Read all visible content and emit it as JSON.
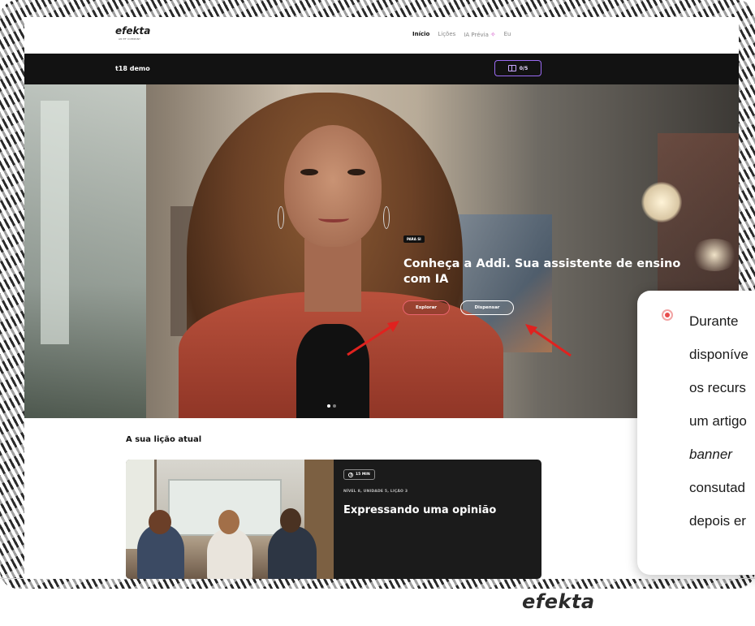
{
  "topnav": {
    "logo": "efekta",
    "logo_sub": "AN EF COMPANY",
    "links": [
      "Início",
      "Lições",
      "IA Prévia",
      "Eu"
    ],
    "sparkle_icon": "sparkle-icon"
  },
  "darkbar": {
    "course": "t18 demo",
    "progress": "0/5",
    "progress_icon": "book-icon",
    "accent": "#9b6bf3"
  },
  "hero": {
    "tag": "PARA SI",
    "title": "Conheça a Addi. Sua assistente de ensino com IA",
    "explore_label": "Explorar",
    "dismiss_label": "Dispensar",
    "explore_color": "#e8646e",
    "slides_total": 2,
    "slide_active": 1
  },
  "current_lesson": {
    "section_title": "A sua lição atual",
    "duration": "15 MIN",
    "meta": "NÍVEL 8, UNIDADE 5, LIÇÃO 3",
    "title": "Expressando uma opinião"
  },
  "callout": {
    "bullet_color": "#e84c4c",
    "lines": [
      "Durante",
      "disponíve",
      "os recurs",
      "um artigo",
      "banner",
      "consutad",
      "depois er"
    ]
  },
  "annotations": {
    "arrow_color": "#e0221f"
  },
  "footer": {
    "logo": "efekta"
  }
}
